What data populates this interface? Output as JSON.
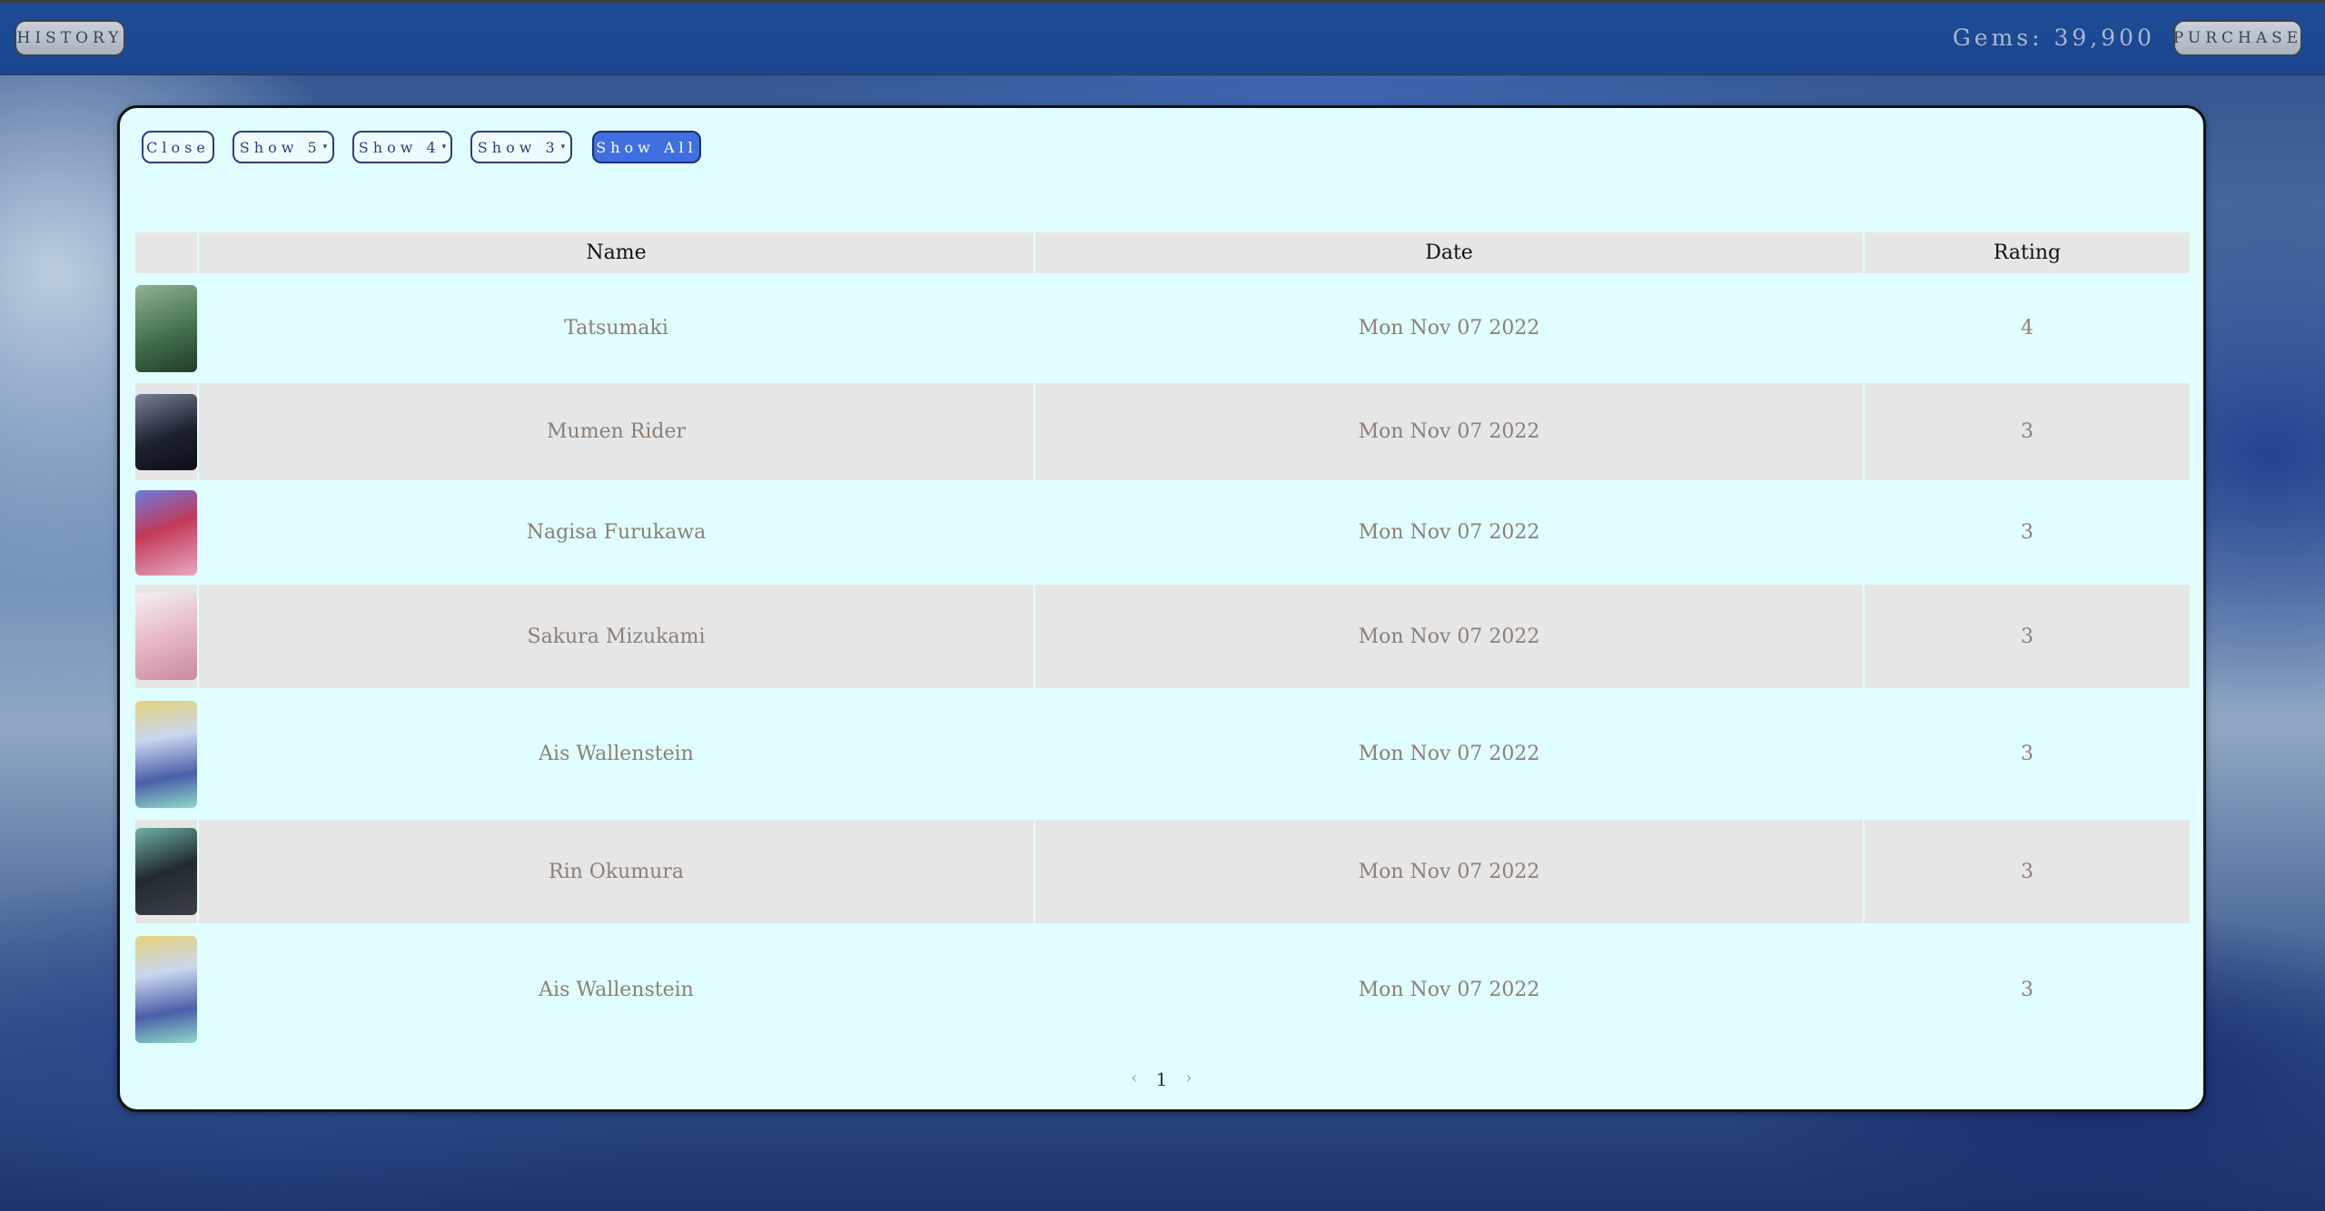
{
  "topbar": {
    "history_label": "HISTORY",
    "gems_text": "Gems: 39,900",
    "purchase_label": "PURCHASE"
  },
  "filters": [
    {
      "label": "Close",
      "caret": "",
      "active": false
    },
    {
      "label": "Show 5",
      "caret": "▾",
      "active": false
    },
    {
      "label": "Show 4",
      "caret": "▾",
      "active": false
    },
    {
      "label": "Show 3",
      "caret": "▾",
      "active": false
    },
    {
      "label": "Show All",
      "caret": "",
      "active": true
    }
  ],
  "table": {
    "headers": [
      "",
      "Name",
      "Date",
      "Rating"
    ],
    "rows": [
      {
        "name": "Tatsumaki",
        "date": "Mon Nov 07 2022",
        "rating": "4",
        "thumb_colors": [
          "#3f6b4a",
          "#8fb391"
        ]
      },
      {
        "name": "Mumen Rider",
        "date": "Mon Nov 07 2022",
        "rating": "3",
        "thumb_colors": [
          "#1d2230",
          "#7a8193"
        ]
      },
      {
        "name": "Nagisa Furukawa",
        "date": "Mon Nov 07 2022",
        "rating": "3",
        "thumb_colors": [
          "#6b7be0",
          "#e8a9c0"
        ]
      },
      {
        "name": "Sakura Mizukami",
        "date": "Mon Nov 07 2022",
        "rating": "3",
        "thumb_colors": [
          "#f4f0f2",
          "#c98aa0"
        ]
      },
      {
        "name": "Ais Wallenstein",
        "date": "Mon Nov 07 2022",
        "rating": "3",
        "thumb_colors": [
          "#c9d6f0",
          "#e5d27a"
        ]
      },
      {
        "name": "Rin Okumura",
        "date": "Mon Nov 07 2022",
        "rating": "3",
        "thumb_colors": [
          "#222a30",
          "#6fb1a4"
        ]
      },
      {
        "name": "Ais Wallenstein",
        "date": "Mon Nov 07 2022",
        "rating": "3",
        "thumb_colors": [
          "#c9d6f0",
          "#e5d27a"
        ]
      }
    ]
  },
  "pagination": {
    "prev": "‹",
    "page": "1",
    "next": "›"
  }
}
